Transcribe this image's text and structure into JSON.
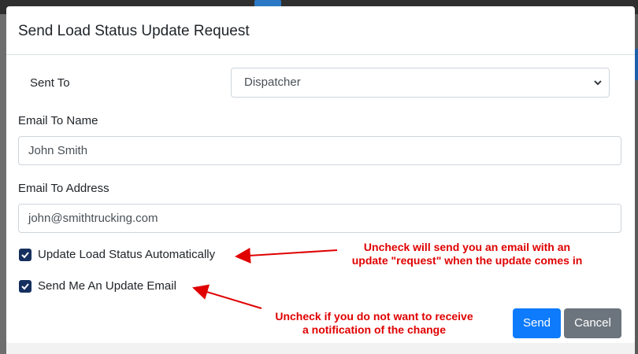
{
  "modal": {
    "title": "Send Load Status Update Request",
    "sent_to": {
      "label": "Sent To",
      "value": "Dispatcher"
    },
    "email_name": {
      "label": "Email To Name",
      "value": "John Smith"
    },
    "email_address": {
      "label": "Email To Address",
      "value": "john@smithtrucking.com"
    },
    "checks": [
      {
        "label": "Update Load Status Automatically",
        "checked": true
      },
      {
        "label": "Send Me An Update Email",
        "checked": true
      }
    ],
    "buttons": {
      "send": "Send",
      "cancel": "Cancel"
    }
  },
  "annotations": {
    "first_line1": "Uncheck will send you an email with an",
    "first_line2": "update \"request\" when the update comes in",
    "second_line1": "Uncheck if you do not want to receive",
    "second_line2": "a notification of the change"
  },
  "colors": {
    "primary": "#0d7bfc",
    "secondary": "#6c757d",
    "checkbox": "#15305f",
    "annotation": "#e00000"
  }
}
